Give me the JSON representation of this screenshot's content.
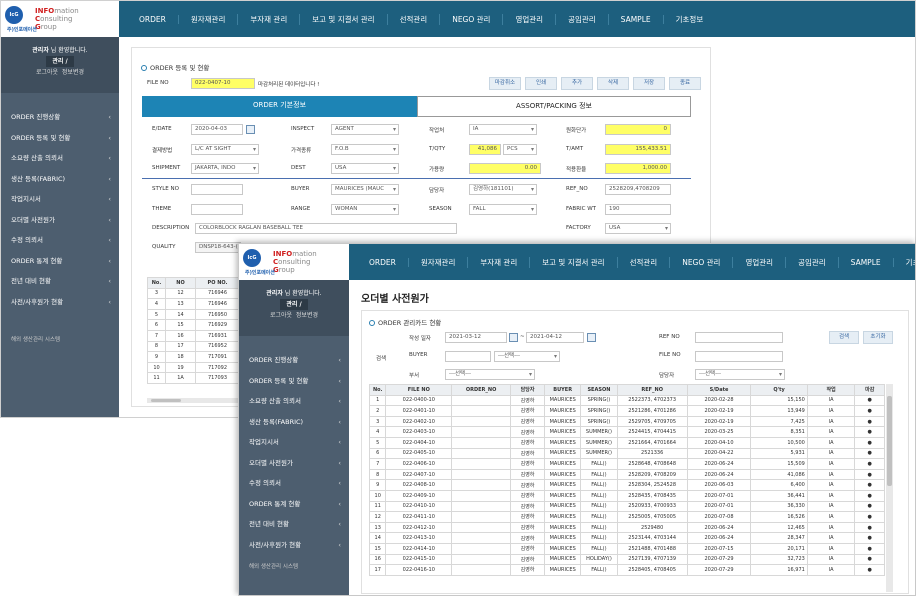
{
  "logo": {
    "l1": "INFO",
    "l1b": "mation",
    "l2": "C",
    "l2b": "onsulting",
    "l3": "G",
    "l3b": "roup",
    "mark": "IcG",
    "sub": "주)인포메이션"
  },
  "nav": [
    "ORDER",
    "원자재관리",
    "부자재 관리",
    "보고 및 지결서 관리",
    "선적관리",
    "NEGO 관리",
    "영업관리",
    "공임관리",
    "SAMPLE",
    "기초정보"
  ],
  "user": {
    "greeting_name": "관리자",
    "greeting_suffix": "님 환영합니다.",
    "role": "관리 /",
    "logout": "로그아웃",
    "info": "정보변경"
  },
  "menu": [
    "ORDER 진행상황",
    "ORDER 등록 및 현황",
    "소요량 산출 의뢰서",
    "생산 등록(FABRIC)",
    "작업지시서",
    "오더별 사전원가",
    "수정 의뢰서",
    "ORDER 통계 현황",
    "전년 대비 현황",
    "사전/사후원가 현황"
  ],
  "footer": "해외 생산관리 시스템",
  "w1": {
    "panel_title": "ORDER 등록 및 현황",
    "fileno_label": "FILE NO",
    "fileno_value": "022-0407-10",
    "fileno_msg": "마감처리된 데이터입니다 !",
    "buttons": [
      "마감취소",
      "인쇄",
      "추가",
      "삭제",
      "저장",
      "종료"
    ],
    "tab_basic": "ORDER 기본정보",
    "tab_assort": "ASSORT/PACKING 정보",
    "f": {
      "edate_l": "E/DATE",
      "edate_v": "2020-04-03",
      "inspect_l": "INSPECT",
      "inspect_v": "AGENT",
      "worker_l": "작업처",
      "worker_v": "IA",
      "unitprice_l": "원화단가",
      "unitprice_v": "0",
      "pay_l": "결제방법",
      "pay_v": "L/C AT SIGHT",
      "price_l": "가격종류",
      "price_v": "F.O.B",
      "tqty_l": "T/QTY",
      "tqty_v": "41,086",
      "tqty_unit": "PCS",
      "tamt_l": "T/AMT",
      "tamt_v": "155,433.51",
      "ship_l": "SHIPMENT",
      "ship_v": "JAKARTA, INDO",
      "dest_l": "DEST",
      "dest_v": "USA",
      "addamt_l": "가용량",
      "addamt_v": "0.00",
      "rate_l": "적용환율",
      "rate_v": "1,000.00",
      "style_l": "STYLE NO",
      "buyer_l": "BUYER",
      "buyer_v": "MAURICES (MAUC",
      "manager_l": "담당자",
      "manager_v": "김영하(181101)",
      "ref_l": "REF_NO",
      "ref_v": "2528209,4708209",
      "theme_l": "THEME",
      "range_l": "RANGE",
      "range_v": "WOMAN",
      "season_l": "SEASON",
      "season_v": "FALL",
      "fwt_l": "FABRIC WT",
      "fwt_v": "190",
      "desc_l": "DESCRIPTION",
      "desc_v": "COLORBLOCK RAGLAN BASEBALL TEE",
      "factory_l": "FACTORY",
      "factory_v": "USA",
      "quality_l": "QUALITY",
      "quality_v": "DNSP18-643-("
    },
    "grid_headers": [
      "No.",
      "NO",
      "PO NO."
    ],
    "grid_rows": [
      [
        "3",
        "12",
        "716946"
      ],
      [
        "4",
        "13",
        "716946"
      ],
      [
        "5",
        "14",
        "716950"
      ],
      [
        "6",
        "15",
        "716929"
      ],
      [
        "7",
        "16",
        "716931"
      ],
      [
        "8",
        "17",
        "716952"
      ],
      [
        "9",
        "18",
        "717091"
      ],
      [
        "10",
        "19",
        "717092"
      ],
      [
        "11",
        "1A",
        "717093"
      ]
    ]
  },
  "w2": {
    "page_title": "오더별 사전원가",
    "panel_title": "ORDER 관리카드 현황",
    "s": {
      "date_l": "작성 일자",
      "date_from": "2021-03-12",
      "date_to": "2021-04-12",
      "tilde": "~",
      "refno_l": "REF NO",
      "group_l": "검색",
      "buyer_l": "BUYER",
      "buyer_sel": "---선택---",
      "fileno_l": "FILE NO",
      "dept_l": "부서",
      "dept_sel": "---선택---",
      "manager_l": "담당자",
      "manager_sel": "---선택---"
    },
    "btn_search": "검색",
    "btn_reset": "초기화",
    "headers": [
      "No.",
      "FILE NO",
      "ORDER_NO",
      "담당자",
      "BUYER",
      "SEASON",
      "REF_NO",
      "S/Date",
      "Q'ty",
      "작업",
      "마감"
    ],
    "rows": [
      [
        "1",
        "022-0400-10",
        "",
        "김영하",
        "MAURICES",
        "SPRING()",
        "2522373, 4702373",
        "2020-02-28",
        "15,150",
        "IA",
        "●"
      ],
      [
        "2",
        "022-0401-10",
        "",
        "김영하",
        "MAURICES",
        "SPRING()",
        "2521286, 4701286",
        "2020-02-19",
        "13,949",
        "IA",
        "●"
      ],
      [
        "3",
        "022-0402-10",
        "",
        "김영하",
        "MAURICES",
        "SPRING()",
        "2529705, 4709705",
        "2020-02-19",
        "7,425",
        "IA",
        "●"
      ],
      [
        "4",
        "022-0403-10",
        "",
        "김영하",
        "MAURICES",
        "SUMMER()",
        "2524415, 4704415",
        "2020-03-25",
        "8,351",
        "IA",
        "●"
      ],
      [
        "5",
        "022-0404-10",
        "",
        "김영하",
        "MAURICES",
        "SUMMER()",
        "2521664, 4701664",
        "2020-04-10",
        "10,500",
        "IA",
        "●"
      ],
      [
        "6",
        "022-0405-10",
        "",
        "김영하",
        "MAURICES",
        "SUMMER()",
        "2521336",
        "2020-04-22",
        "5,931",
        "IA",
        "●"
      ],
      [
        "7",
        "022-0406-10",
        "",
        "김영하",
        "MAURICES",
        "FALL()",
        "2528648, 4708648",
        "2020-06-24",
        "15,509",
        "IA",
        "●"
      ],
      [
        "8",
        "022-0407-10",
        "",
        "김영하",
        "MAURICES",
        "FALL()",
        "2528209, 4708209",
        "2020-06-24",
        "41,086",
        "IA",
        "●"
      ],
      [
        "9",
        "022-0408-10",
        "",
        "김영하",
        "MAURICES",
        "FALL()",
        "2528304, 2524528",
        "2020-06-03",
        "6,400",
        "IA",
        "●"
      ],
      [
        "10",
        "022-0409-10",
        "",
        "김영하",
        "MAURICES",
        "FALL()",
        "2528435, 4708435",
        "2020-07-01",
        "36,441",
        "IA",
        "●"
      ],
      [
        "11",
        "022-0410-10",
        "",
        "김영하",
        "MAURICES",
        "FALL()",
        "2520933, 4700933",
        "2020-07-01",
        "36,330",
        "IA",
        "●"
      ],
      [
        "12",
        "022-0411-10",
        "",
        "김영하",
        "MAURICES",
        "FALL()",
        "2525005, 4705005",
        "2020-07-08",
        "16,526",
        "IA",
        "●"
      ],
      [
        "13",
        "022-0412-10",
        "",
        "김영하",
        "MAURICES",
        "FALL()",
        "2529480",
        "2020-06-24",
        "12,465",
        "IA",
        "●"
      ],
      [
        "14",
        "022-0413-10",
        "",
        "김영하",
        "MAURICES",
        "FALL()",
        "2523144, 4703144",
        "2020-06-24",
        "28,347",
        "IA",
        "●"
      ],
      [
        "15",
        "022-0414-10",
        "",
        "김영하",
        "MAURICES",
        "FALL()",
        "2521488, 4701488",
        "2020-07-15",
        "20,171",
        "IA",
        "●"
      ],
      [
        "16",
        "022-0415-10",
        "",
        "김영하",
        "MAURICES",
        "HOLIDAY()",
        "2527139, 4707139",
        "2020-07-29",
        "32,723",
        "IA",
        "●"
      ],
      [
        "17",
        "022-0416-10",
        "",
        "김영하",
        "MAURICES",
        "FALL()",
        "2528405, 4708405",
        "2020-07-29",
        "16,971",
        "IA",
        "●"
      ]
    ]
  }
}
